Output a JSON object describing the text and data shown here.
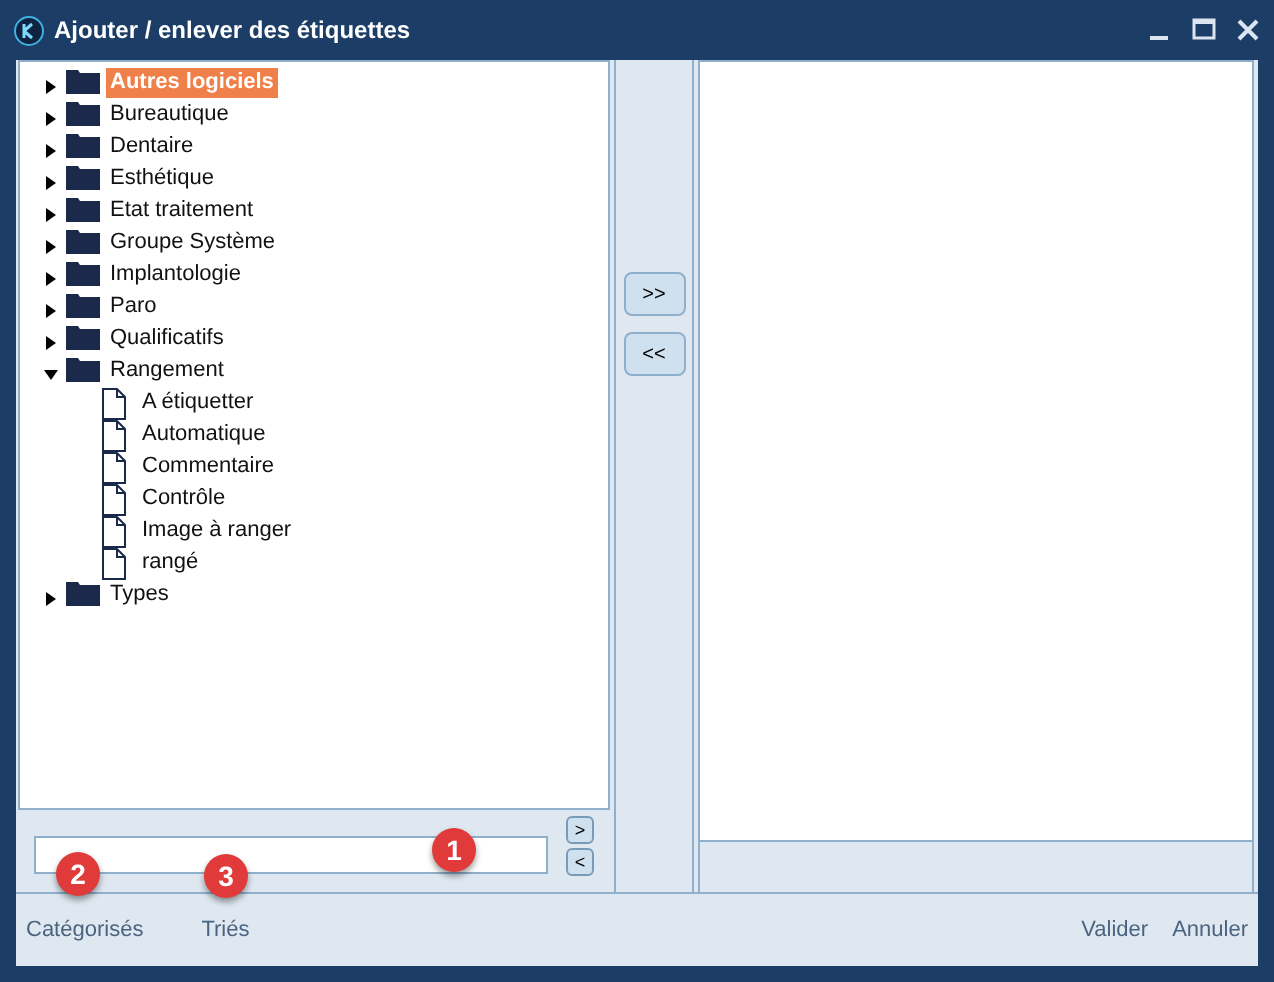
{
  "window": {
    "title": "Ajouter / enlever des étiquettes"
  },
  "tree": [
    {
      "label": "Autres logiciels",
      "expanded": false,
      "selected": true
    },
    {
      "label": "Bureautique",
      "expanded": false,
      "selected": false
    },
    {
      "label": "Dentaire",
      "expanded": false,
      "selected": false
    },
    {
      "label": "Esthétique",
      "expanded": false,
      "selected": false
    },
    {
      "label": "Etat traitement",
      "expanded": false,
      "selected": false
    },
    {
      "label": "Groupe Système",
      "expanded": false,
      "selected": false
    },
    {
      "label": "Implantologie",
      "expanded": false,
      "selected": false
    },
    {
      "label": "Paro",
      "expanded": false,
      "selected": false
    },
    {
      "label": "Qualificatifs",
      "expanded": false,
      "selected": false
    },
    {
      "label": "Rangement",
      "expanded": true,
      "selected": false,
      "children": [
        {
          "label": "A étiquetter",
          "selected": false
        },
        {
          "label": "Automatique",
          "selected": false
        },
        {
          "label": "Commentaire",
          "selected": false
        },
        {
          "label": "Contrôle",
          "selected": false
        },
        {
          "label": "Image à ranger",
          "selected": false
        },
        {
          "label": "rangé",
          "selected": false
        }
      ]
    },
    {
      "label": "Types",
      "expanded": false,
      "selected": false
    }
  ],
  "move_buttons": [
    ">>",
    "<<"
  ],
  "search_buttons": [
    ">",
    "<"
  ],
  "callouts": [
    "1",
    "2",
    "3"
  ],
  "footer_left": [
    "Catégorisés",
    "Triés"
  ],
  "footer_right": [
    "Valider",
    "Annuler"
  ]
}
